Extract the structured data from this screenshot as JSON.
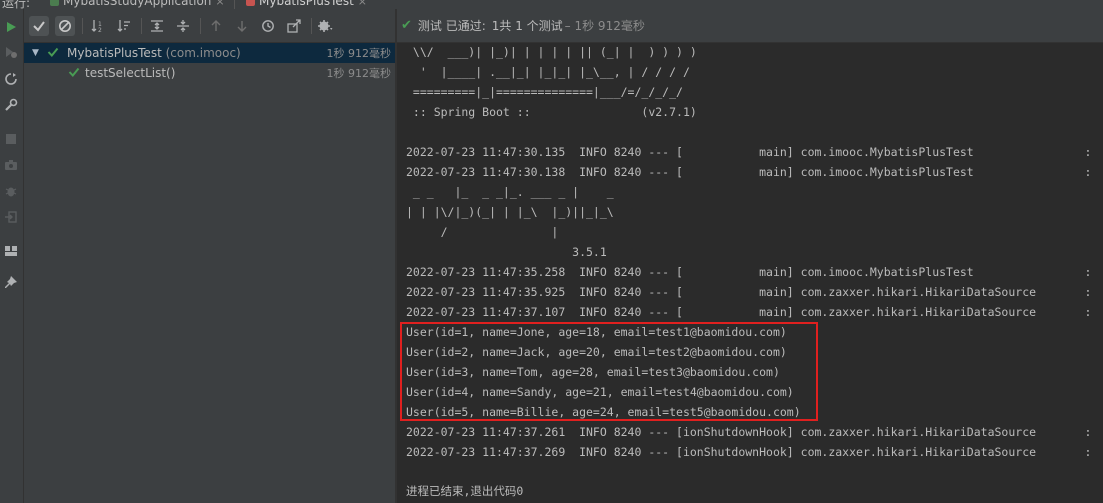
{
  "top": {
    "run_label": "运行:",
    "tabs": [
      {
        "label": "MybatisStudyApplication",
        "close": "×"
      },
      {
        "label": "MybatisPlusTest",
        "close": "×"
      }
    ]
  },
  "status": {
    "check": "✔",
    "label": "测试 已通过:",
    "count": "1共 1 个测试",
    "duration": "– 1秒 912毫秒"
  },
  "tree": {
    "root": {
      "name": "MybatisPlusTest",
      "package": "(com.imooc)",
      "time": "1秒 912毫秒"
    },
    "child": {
      "name": "testSelectList()",
      "time": "1秒 912毫秒"
    }
  },
  "console_lines": [
    " \\\\/  ___)| |_)| | | | | || (_| |  ) ) ) )",
    "  '  |____| .__|_| |_|_| |_\\__, | / / / /",
    " =========|_|==============|___/=/_/_/_/",
    " :: Spring Boot ::                (v2.7.1)",
    "",
    "2022-07-23 11:47:30.135  INFO 8240 --- [           main] com.imooc.MybatisPlusTest                :",
    "2022-07-23 11:47:30.138  INFO 8240 --- [           main] com.imooc.MybatisPlusTest                :",
    " _ _   |_  _ _|_. ___ _ |    _",
    "| | |\\/|_)(_| | |_\\  |_)||_|_\\",
    "     /               |",
    "                        3.5.1",
    "2022-07-23 11:47:35.258  INFO 8240 --- [           main] com.imooc.MybatisPlusTest                :",
    "2022-07-23 11:47:35.925  INFO 8240 --- [           main] com.zaxxer.hikari.HikariDataSource       :",
    "2022-07-23 11:47:37.107  INFO 8240 --- [           main] com.zaxxer.hikari.HikariDataSource       :",
    "User(id=1, name=Jone, age=18, email=test1@baomidou.com)",
    "User(id=2, name=Jack, age=20, email=test2@baomidou.com)",
    "User(id=3, name=Tom, age=28, email=test3@baomidou.com)",
    "User(id=4, name=Sandy, age=21, email=test4@baomidou.com)",
    "User(id=5, name=Billie, age=24, email=test5@baomidou.com)",
    "2022-07-23 11:47:37.261  INFO 8240 --- [ionShutdownHook] com.zaxxer.hikari.HikariDataSource       :",
    "2022-07-23 11:47:37.269  INFO 8240 --- [ionShutdownHook] com.zaxxer.hikari.HikariDataSource       :",
    "",
    "进程已结束,退出代码0"
  ],
  "icons": {
    "run": "run-icon",
    "rerun-failed": "rerun-failed-icon",
    "toggle-auto-test": "toggle-auto-test-icon",
    "settings": "wrench-icon",
    "stop": "stop-icon",
    "dump": "camera-icon",
    "debug": "bug-icon",
    "exit": "exit-icon",
    "layout": "layout-icon",
    "pin": "pin-icon",
    "show-passed": "show-passed-icon",
    "show-ignored": "show-ignored-icon",
    "sort-alpha": "sort-alpha-icon",
    "sort-duration": "sort-duration-icon",
    "expand": "expand-all-icon",
    "collapse": "collapse-all-icon",
    "prev": "previous-failed-icon",
    "next": "next-failed-icon",
    "history": "test-history-icon",
    "export": "export-icon",
    "gear": "gear-icon"
  },
  "colors": {
    "pass": "#499c54",
    "highlight": "#e0201f",
    "selected": "#0d293e"
  }
}
